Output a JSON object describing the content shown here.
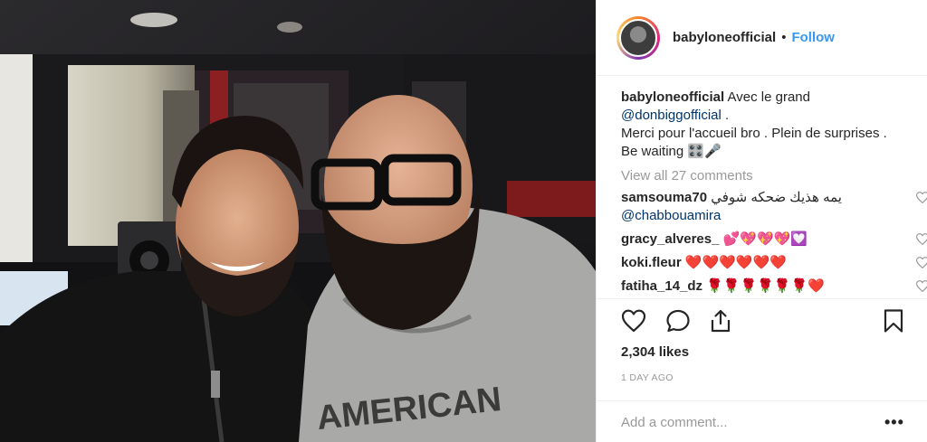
{
  "post": {
    "username": "babyloneofficial",
    "dot": "•",
    "follow_label": "Follow",
    "caption": {
      "username": "babyloneofficial",
      "text_1": " Avec le grand",
      "mention": "@donbiggofficial",
      "text_2": " .",
      "text_3": "Merci pour l'accueil bro . Plein de surprises .",
      "text_4": "Be waiting 🎛️🎤"
    },
    "view_all": "View all 27 comments",
    "comments": [
      {
        "username": "samsouma70",
        "text": " يمه هذيك ضحكه شوفي",
        "mention": "@chabbouamira"
      },
      {
        "username": "gracy_alveres_",
        "text": " 💕💖💖💖💟"
      },
      {
        "username": "koki.fleur",
        "text": " ❤️❤️❤️❤️❤️❤️"
      },
      {
        "username": "fatiha_14_dz",
        "text": " 🌹🌹🌹🌹🌹🌹❤️"
      }
    ],
    "likes": "2,304 likes",
    "time": "1 DAY AGO",
    "add_comment_placeholder": "Add a comment...",
    "more_label": "•••"
  },
  "icons": [
    "heart-icon",
    "comment-icon",
    "share-icon",
    "bookmark-icon",
    "more-icon"
  ],
  "colors": {
    "follow": "#3897f0",
    "mention": "#003569",
    "muted": "#999999",
    "border": "#efefef"
  }
}
